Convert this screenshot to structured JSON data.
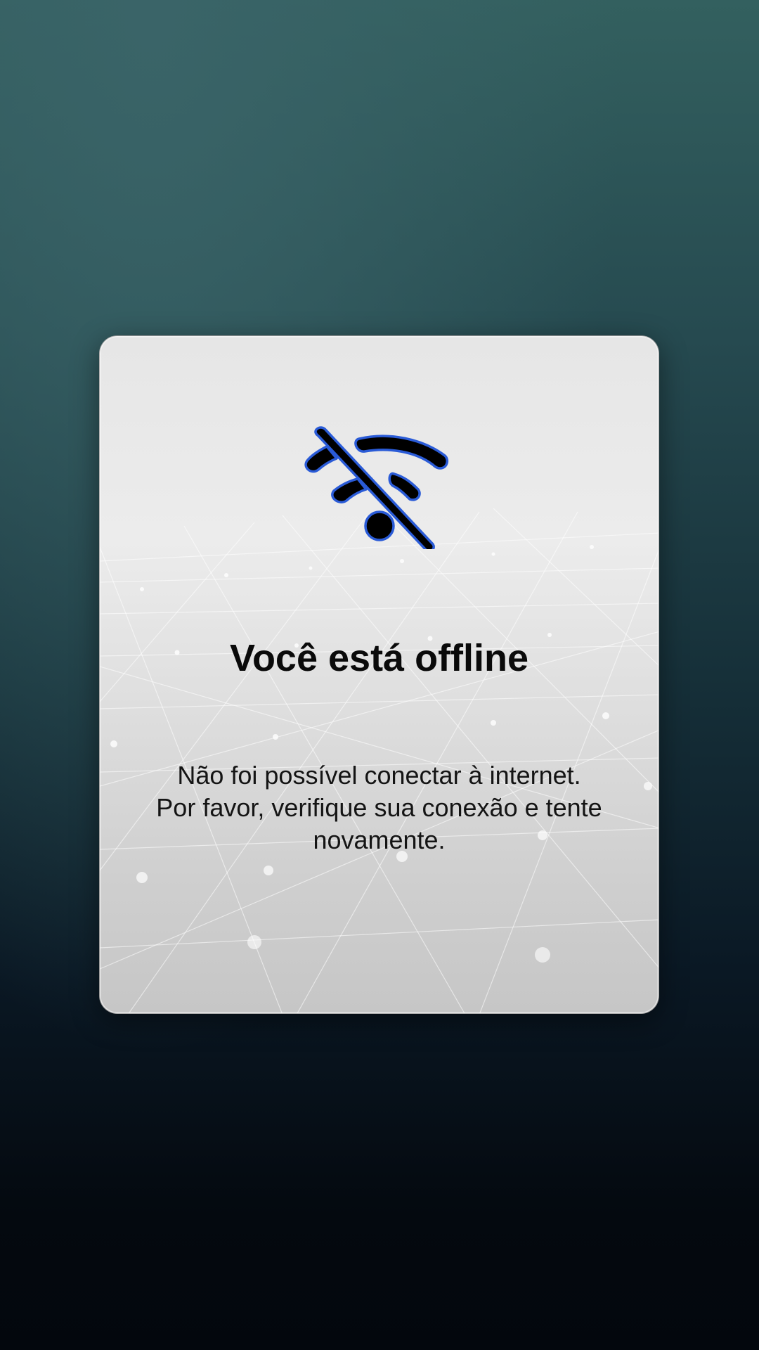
{
  "dialog": {
    "icon": "wifi-off-icon",
    "title": "Você está offline",
    "message_lines": [
      "Não foi possível conectar à internet.",
      "Por favor, verifique sua conexão e tente",
      "novamente."
    ]
  },
  "colors": {
    "background_top": "#33605f",
    "background_bottom": "#03070d",
    "card": "#e6e6e6",
    "icon_fill": "#000000",
    "icon_outline": "#2a5bd7",
    "text": "#0a0a0a"
  }
}
